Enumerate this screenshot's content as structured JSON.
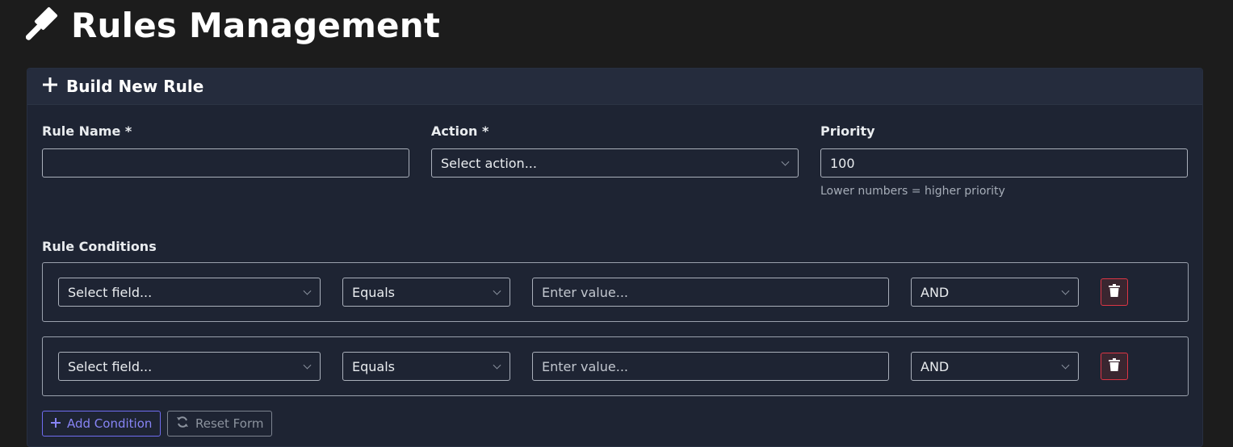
{
  "header": {
    "title": "Rules Management",
    "icon": "gavel-icon"
  },
  "card": {
    "title": "Build New Rule",
    "icon": "plus-icon"
  },
  "form": {
    "rule_name": {
      "label": "Rule Name *",
      "value": "",
      "placeholder": ""
    },
    "action": {
      "label": "Action *",
      "selected": "Select action..."
    },
    "priority": {
      "label": "Priority",
      "value": "100",
      "help": "Lower numbers = higher priority"
    }
  },
  "conditions": {
    "label": "Rule Conditions",
    "rows": [
      {
        "field": "Select field...",
        "operator": "Equals",
        "value_placeholder": "Enter value...",
        "logic": "AND"
      },
      {
        "field": "Select field...",
        "operator": "Equals",
        "value_placeholder": "Enter value...",
        "logic": "AND"
      }
    ]
  },
  "buttons": {
    "add_condition": "Add Condition",
    "reset_form": "Reset Form"
  },
  "colors": {
    "background": "#1c1c1c",
    "card": "#1e2433",
    "card_header": "#252c3d",
    "danger": "#dc3545",
    "accent": "#6f6cf0"
  }
}
